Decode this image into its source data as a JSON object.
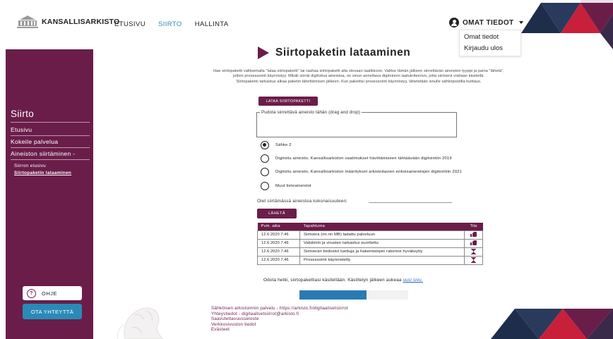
{
  "header": {
    "logo_text": "KANSALLISARKISTO",
    "nav": [
      {
        "label": "ETUSIVU",
        "active": false
      },
      {
        "label": "SIIRTO",
        "active": true
      },
      {
        "label": "HALLINTA",
        "active": false
      }
    ],
    "user_menu_label": "OMAT TIEDOT",
    "dropdown": [
      "Omat tiedot",
      "Kirjaudu ulos"
    ]
  },
  "sidebar": {
    "title": "Siirto",
    "items": [
      "Etusivu",
      "Kokeile palvelua",
      "Aineiston siirtäminen -"
    ],
    "subitems": [
      "Siirron etusivu",
      "Siirtopaketin lataaminen"
    ],
    "help_label": "OHJE",
    "contact_label": "OTA YHTEYTTÄ"
  },
  "main": {
    "title": "Siirtopaketin lataaminen",
    "intro": [
      "Hae siirtopaketti valitsemalla \"lataa siirtopaketti\" tai raahaa siirtopaketti alla olevaan laatikkoon. Valitse tämän jälkeen siirrettävän aineiston tyyppi ja paina \"lähetä\",",
      "jolloin prosessointi käynnistyy. Mikäli siirrät digitoitua aineistoa, on sinun annettava digitoinnin laatukriteerivo, jotta siirtoerä voidaan käsitellä.",
      "Siirtopaketin tarkastus alkaa paketin lähettämisen jälkeen. Kun pakettisi prosessointi käynnistyy, lähetetään sinulle sähköpostilla kuittaus."
    ],
    "upload_button": "LATAA SIIRTOPAKETTI",
    "dropzone_label": "Pudota siirrettävä aineisto tähän (drag and drop)",
    "options": [
      {
        "label": "Sähke 2",
        "checked": true
      },
      {
        "label": "Digitoitu aineisto, Kansallisarkiston vaatimukset hävittämiseen tähtäävään digitointiin 2019",
        "checked": false
      },
      {
        "label": "Digitoitu aineisto, Kansallisarkiston määritykset arkistoitavien erikoisaineistojen digitointiin 2021",
        "checked": false
      },
      {
        "label": "Muut tietoaineistot",
        "checked": false
      }
    ],
    "total_label": "Olet siirtämässä aineistoa kokonaisuuteen:",
    "send_button": "LÄHETÄ",
    "log": {
      "headers": [
        "Pvm. aika",
        "Tapahtuma",
        "Tila"
      ],
      "rows": [
        {
          "date": "12.6.2020 7.46",
          "event": "Siirtoerä (nn.nn MB) ladattu palveluun",
          "status": "thumbs-up-icon"
        },
        {
          "date": "12.6.2020 7.46",
          "event": "Validointi ja virusten tarkastus suoritettu",
          "status": "thumbs-up-icon"
        },
        {
          "date": "12.6.2020 7.46",
          "event": "Siirtoerän tiedostot tuettuja ja hakemistojen rakenne hyväksytty",
          "status": "hourglass-icon"
        },
        {
          "date": "12.6.2020 7.46",
          "event": "Prosessointi käynnistetty",
          "status": "hourglass-icon"
        }
      ]
    },
    "wait_text": "Odota hetki, siirtopakettiasi käsitellään. Käsittelyn jälkeen aukeaa",
    "wait_link": "uusi sivu.",
    "progress_fraction": 0.62
  },
  "footer": {
    "lines": [
      "Sähköisen arkistoinnin palvelu - https://arkisto.fi/digitaalisetsiirrot",
      "Yhteystiedot - digitaalisetsiirrot@arkisto.fi",
      "Saavutettavuusseloste",
      "Verkkosivuston tiedot",
      "Evästeet"
    ]
  },
  "colors": {
    "brand": "#6b1d4a",
    "accent": "#2a8ab7",
    "navy": "#1e2d4a",
    "red": "#c8203a"
  }
}
